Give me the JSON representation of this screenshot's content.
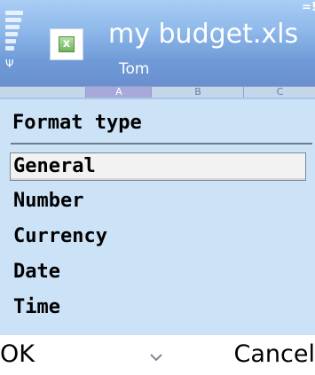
{
  "titlebar": {
    "title": "my budget.xls",
    "subtitle": "Tom",
    "indicator": "=!"
  },
  "sheet": {
    "columns": [
      "A",
      "B",
      "C"
    ]
  },
  "popup": {
    "heading": "Format type",
    "items": [
      {
        "label": "General",
        "selected": true
      },
      {
        "label": "Number"
      },
      {
        "label": "Currency"
      },
      {
        "label": "Date"
      },
      {
        "label": "Time"
      }
    ]
  },
  "softkeys": {
    "left": "OK",
    "center_icon": "chevron-down-icon",
    "right": "Cancel"
  },
  "colors": {
    "popup_bg": "#cbe2f7",
    "titlebar": "#8fb9ea",
    "selection": "#f2f2f2"
  }
}
